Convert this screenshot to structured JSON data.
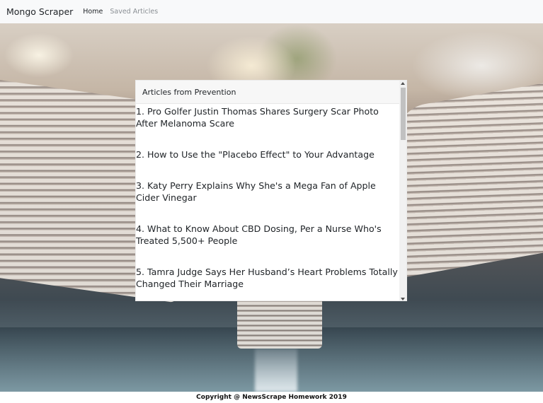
{
  "navbar": {
    "brand": "Mongo Scraper",
    "links": [
      {
        "label": "Home"
      },
      {
        "label": "Saved Articles"
      }
    ]
  },
  "card": {
    "title": "Articles from Prevention",
    "articles": [
      {
        "text": "1. Pro Golfer Justin Thomas Shares Surgery Scar Photo After Melanoma Scare"
      },
      {
        "text": "2. How to Use the \"Placebo Effect\" to Your Advantage"
      },
      {
        "text": "3. Katy Perry Explains Why She's a Mega Fan of Apple Cider Vinegar"
      },
      {
        "text": "4. What to Know About CBD Dosing, Per a Nurse Who's Treated 5,500+ People"
      },
      {
        "text": "5. Tamra Judge Says Her Husband’s Heart Problems Totally Changed Their Marriage"
      }
    ]
  },
  "footer": {
    "text": "Copyright @ NewsScrape Homework 2019"
  }
}
